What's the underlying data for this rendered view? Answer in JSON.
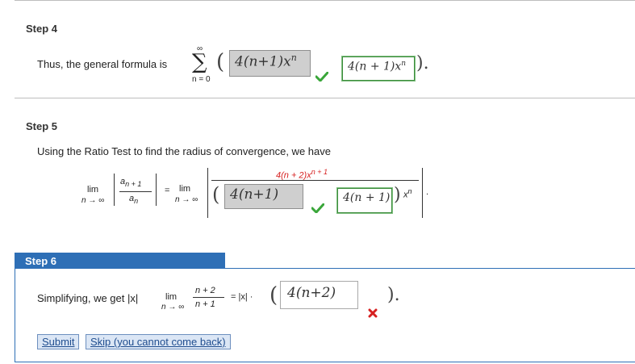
{
  "step4": {
    "title": "Step 4",
    "text": "Thus, the general formula is",
    "sum_upper": "∞",
    "sum_lower": "n = 0",
    "open_paren": "(",
    "answer_given": "4(n+1)x",
    "answer_given_exp": "n",
    "answer_expected": "4(n + 1)x",
    "answer_expected_exp": "n",
    "close_paren": ").",
    "status": "correct"
  },
  "step5": {
    "title": "Step 5",
    "text": "Using the Ratio Test to find the radius of convergence, we have",
    "lim": "lim",
    "lim_sub": "n → ∞",
    "frac_num": "a",
    "frac_num_sub": "n + 1",
    "frac_den": "a",
    "frac_den_sub": "n",
    "equals": "=",
    "rhs_lim": "lim",
    "rhs_lim_sub": "n → ∞",
    "numerator": "4(n + 2)x",
    "numerator_exp": "n + 1",
    "open_paren": "(",
    "answer_given": "4(n+1)",
    "answer_expected": "4(n + 1)",
    "close_paren": ")",
    "den_var": "x",
    "den_exp": "n",
    "trailing": ".",
    "status": "correct"
  },
  "step6": {
    "title": "Step 6",
    "text": "Simplifying, we get |x|",
    "lim": "lim",
    "lim_sub": "n → ∞",
    "frac_num": "n + 2",
    "frac_den": "n + 1",
    "equals_abs": "= |x| ·",
    "open_paren": "(",
    "answer_input": "4(n+2)",
    "close_paren": ").",
    "status": "incorrect",
    "submit_label": "Submit",
    "skip_label": "Skip (you cannot come back)"
  },
  "colors": {
    "accent_blue": "#2e6fb6",
    "correct_green": "#3aa63a",
    "incorrect_red": "#d62020",
    "highlight_red": "#d62020"
  }
}
